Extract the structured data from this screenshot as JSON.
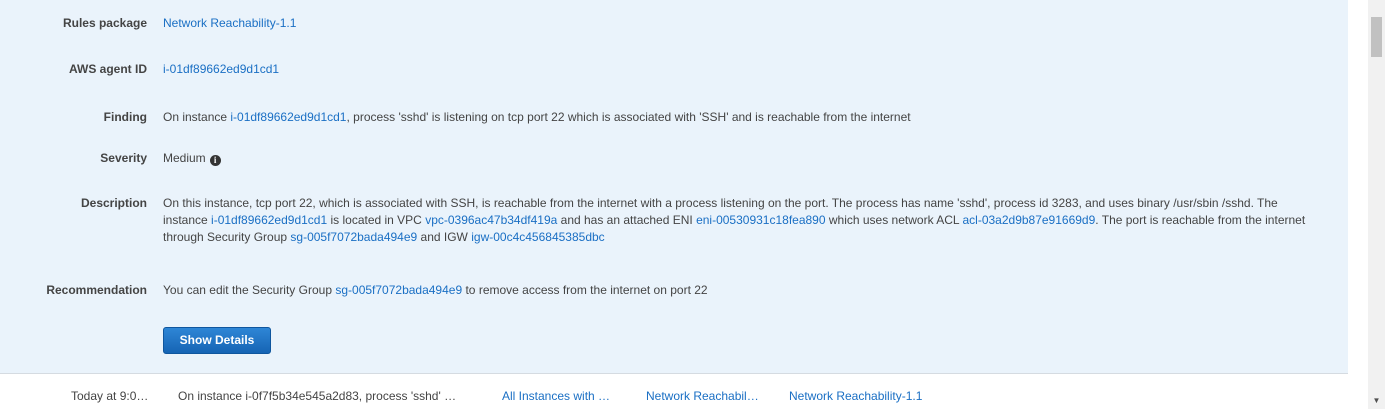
{
  "details": {
    "rules_package": {
      "label": "Rules package",
      "link": "Network Reachability-1.1"
    },
    "agent_id": {
      "label": "AWS agent ID",
      "link": "i-01df89662ed9d1cd1"
    },
    "finding": {
      "label": "Finding",
      "prefix": "On instance ",
      "instance": "i-01df89662ed9d1cd1",
      "suffix": ", process 'sshd' is listening on tcp port 22 which is associated with 'SSH' and is reachable from the internet"
    },
    "severity": {
      "label": "Severity",
      "value": "Medium",
      "info_icon": "info-circle-icon"
    },
    "description": {
      "label": "Description",
      "part1": "On this instance, tcp port 22, which is associated with SSH, is reachable from the internet with a process listening on the port. The process has name 'sshd', process id 3283, and uses binary /usr/sbin /sshd. The instance ",
      "instance": "i-01df89662ed9d1cd1",
      "part2": " is located in VPC ",
      "vpc": "vpc-0396ac47b34df419a",
      "part3": " and has an attached ENI ",
      "eni": "eni-00530931c18fea890",
      "part4": " which uses network ACL ",
      "acl": "acl-03a2d9b87e91669d9",
      "part5": ". The port is reachable from the internet through Security Group ",
      "sg": "sg-005f7072bada494e9",
      "part6": " and IGW ",
      "igw": "igw-00c4c456845385dbc"
    },
    "recommendation": {
      "label": "Recommendation",
      "prefix": "You can edit the Security Group ",
      "sg": "sg-005f7072bada494e9",
      "suffix": " to remove access from the internet on port 22"
    },
    "show_details_label": "Show Details"
  },
  "table_row": {
    "time": "Today at 9:0…",
    "finding": "On instance i-0f7f5b34e545a2d83, process 'sshd' …",
    "target": "All Instances with …",
    "template": "Network Reachabil…",
    "rules_package": "Network Reachability-1.1"
  },
  "colors": {
    "panel_bg": "#eaf3fb",
    "link": "#1a6fc4",
    "button": "#1b6fc0"
  }
}
